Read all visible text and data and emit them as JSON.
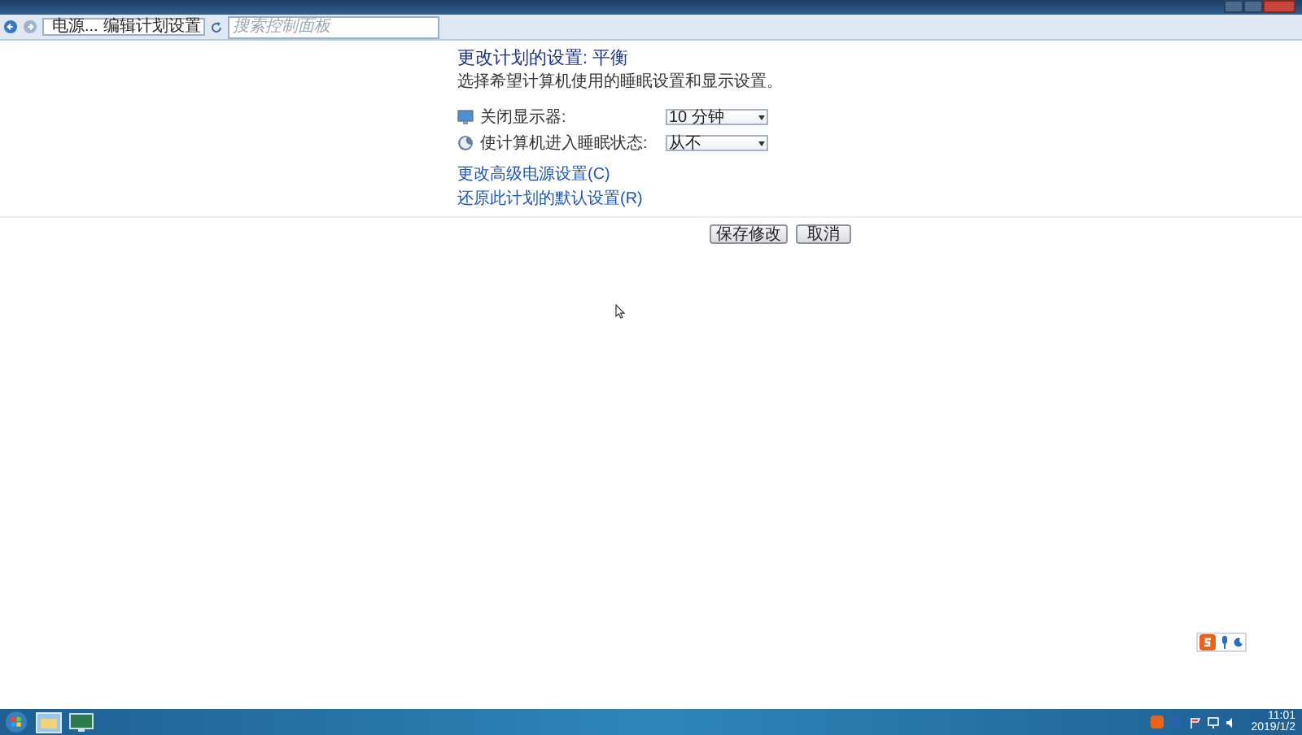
{
  "address_bar": {
    "breadcrumbs": [
      "电源...",
      "编辑计划设置"
    ],
    "search": {
      "placeholder": "搜索控制面板"
    }
  },
  "heading": "更改计划的设置: 平衡",
  "subtitle": "选择希望计算机使用的睡眠设置和显示设置。",
  "settings": [
    {
      "kind": "display",
      "label": "关闭显示器:",
      "value": "10 分钟"
    },
    {
      "kind": "sleep",
      "label": "使计算机进入睡眠状态:",
      "value": "从不"
    }
  ],
  "links": [
    "更改高级电源设置(C)",
    "还原此计划的默认设置(R)"
  ],
  "buttons": [
    "保存修改",
    "取消"
  ],
  "taskbar": {
    "time": "11:01",
    "date": "2019/1/2"
  }
}
